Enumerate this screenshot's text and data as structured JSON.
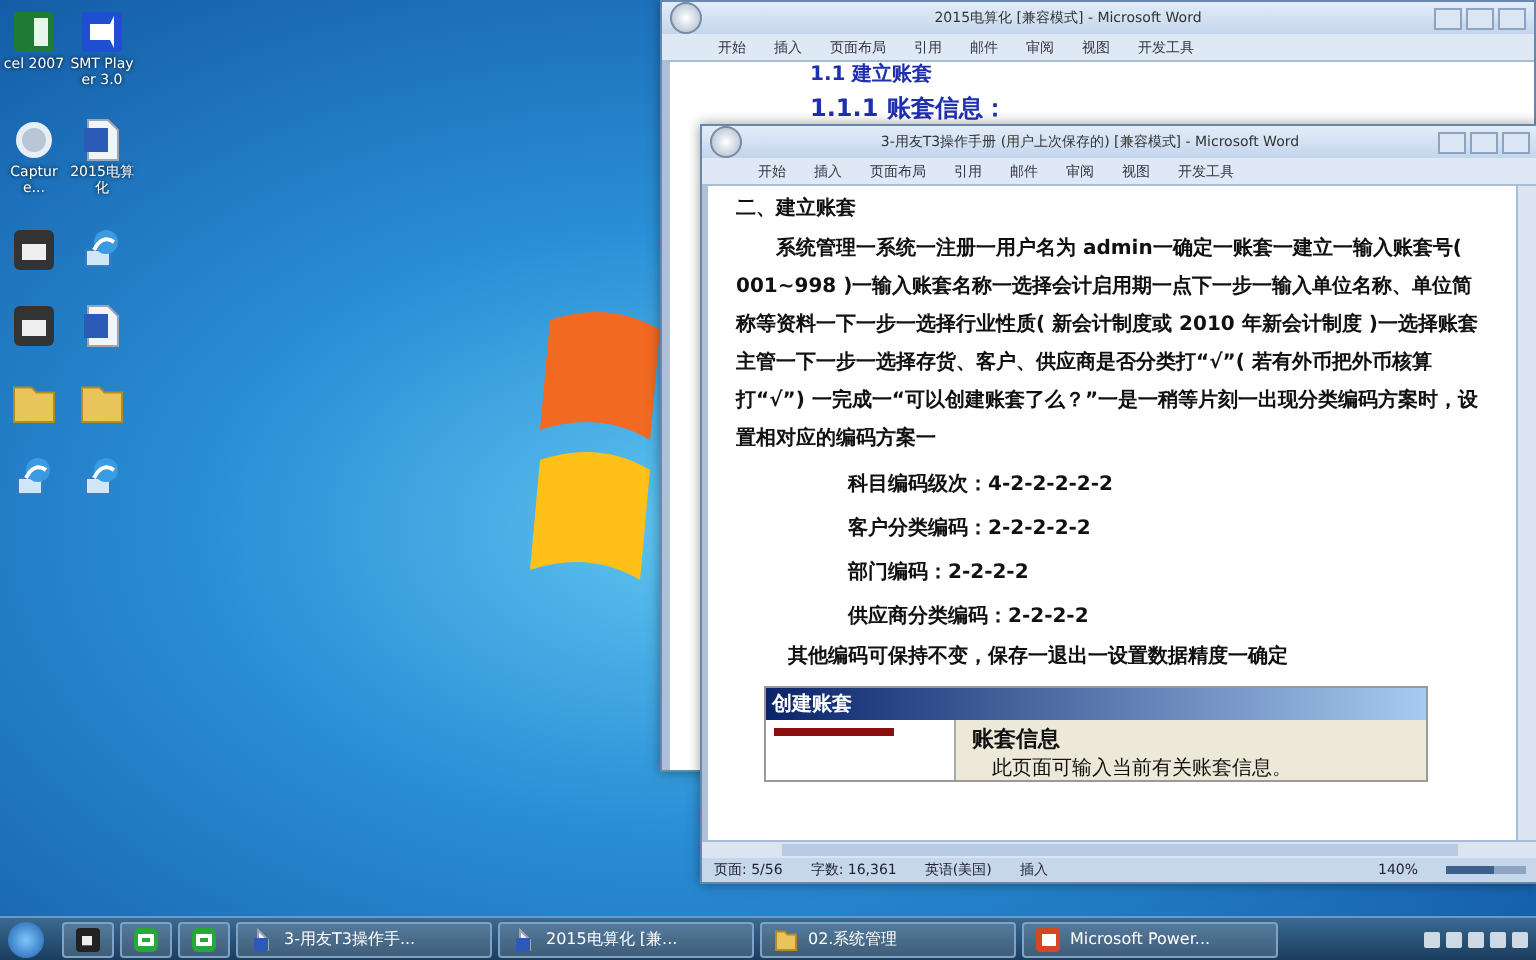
{
  "desktop_icons": [
    {
      "label": "cel 2007",
      "kind": "excel"
    },
    {
      "label": "SMT Player 3.0",
      "kind": "player"
    },
    {
      "label": "Capture...",
      "kind": "capture"
    },
    {
      "label": "2015电算化",
      "kind": "document"
    },
    {
      "kind": "camera"
    },
    {
      "kind": "network"
    },
    {
      "kind": "camera"
    },
    {
      "kind": "document"
    },
    {
      "kind": "folder"
    },
    {
      "kind": "folder"
    },
    {
      "kind": "network"
    },
    {
      "kind": "network"
    }
  ],
  "back_window": {
    "title": "2015电算化 [兼容模式] - Microsoft Word",
    "ribbon_tabs": [
      "开始",
      "插入",
      "页面布局",
      "引用",
      "邮件",
      "审阅",
      "视图",
      "开发工具"
    ],
    "headings": [
      "1.1   建立账套",
      "1.1.1 账套信息："
    ]
  },
  "front_window": {
    "title": "3-用友T3操作手册 (用户上次保存的) [兼容模式] - Microsoft Word",
    "ribbon_tabs": [
      "开始",
      "插入",
      "页面布局",
      "引用",
      "邮件",
      "审阅",
      "视图",
      "开发工具"
    ],
    "heading": "二、建立账套",
    "paragraph": "系统管理一系统一注册一用户名为 admin一确定一账套一建立一输入账套号( 001~998 )一输入账套名称一选择会计启用期一点下一步一输入单位名称、单位简称等资料一下一步一选择行业性质( 新会计制度或 2010 年新会计制度 )一选择账套主管一下一步一选择存货、客户、供应商是否分类打“√”( 若有外币把外币核算打“√”) 一完成一“可以创建账套了么？”一是一稍等片刻一出现分类编码方案时，设置相对应的编码方案一",
    "codes": [
      "科目编码级次：4-2-2-2-2-2",
      "客户分类编码：2-2-2-2-2",
      "部门编码：2-2-2-2",
      "供应商分类编码：2-2-2-2"
    ],
    "closing": "其他编码可保持不变，保存一退出一设置数据精度一确定",
    "embedded_dialog": {
      "title": "创建账套",
      "heading": "账套信息",
      "note": "此页面可输入当前有关账套信息。"
    },
    "status_bar": [
      "页面: 5/56",
      "字数: 16,361",
      "英语(美国)",
      "插入"
    ],
    "zoom": "140%",
    "zoom_slider": {
      "level": 0.6
    }
  },
  "taskbar": [
    {
      "kind": "recorder"
    },
    {
      "kind": "green"
    },
    {
      "kind": "green"
    },
    {
      "label": "3-用友T3操作手...",
      "kind": "document"
    },
    {
      "label": "2015电算化 [兼...",
      "kind": "document"
    },
    {
      "label": "02.系统管理",
      "kind": "folder"
    },
    {
      "label": "Microsoft Power...",
      "kind": "powerpoint"
    }
  ]
}
